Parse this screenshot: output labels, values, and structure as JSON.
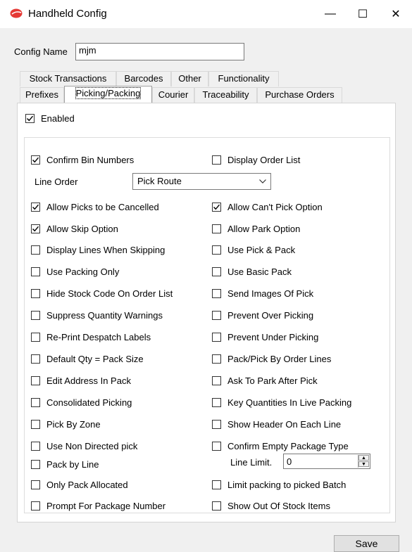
{
  "window": {
    "title": "Handheld Config",
    "minimize": "—",
    "maximize": "☐",
    "close": "✕"
  },
  "config_name": {
    "label": "Config Name",
    "value": "mjm"
  },
  "tabs_row1": [
    "Stock Transactions",
    "Barcodes",
    "Other",
    "Functionality"
  ],
  "tabs_row2": [
    "Prefixes",
    "Picking/Packing",
    "Courier",
    "Traceability",
    "Purchase Orders"
  ],
  "active_tab": "Picking/Packing",
  "enabled": {
    "label": "Enabled",
    "checked": true
  },
  "line_order": {
    "label": "Line Order",
    "value": "Pick Route"
  },
  "line_limit": {
    "label": "Line Limit.",
    "value": "0"
  },
  "left_options": [
    {
      "label": "Confirm Bin Numbers",
      "checked": true
    },
    {
      "label": "Allow Picks to be Cancelled",
      "checked": true
    },
    {
      "label": "Allow Skip Option",
      "checked": true
    },
    {
      "label": "Display Lines When Skipping",
      "checked": false
    },
    {
      "label": "Use Packing Only",
      "checked": false
    },
    {
      "label": "Hide Stock Code On Order List",
      "checked": false
    },
    {
      "label": "Suppress Quantity Warnings",
      "checked": false
    },
    {
      "label": "Re-Print Despatch Labels",
      "checked": false
    },
    {
      "label": "Default Qty = Pack Size",
      "checked": false
    },
    {
      "label": "Edit Address In Pack",
      "checked": false
    },
    {
      "label": "Consolidated Picking",
      "checked": false
    },
    {
      "label": "Pick By Zone",
      "checked": false
    },
    {
      "label": "Use Non Directed pick",
      "checked": false
    },
    {
      "label": "Pack by Line",
      "checked": false
    },
    {
      "label": "Only Pack Allocated",
      "checked": false
    },
    {
      "label": "Prompt For Package Number",
      "checked": false
    }
  ],
  "right_options": [
    {
      "label": "Display Order List",
      "checked": false
    },
    {
      "label": "Allow Can't Pick Option",
      "checked": true
    },
    {
      "label": "Allow Park Option",
      "checked": false
    },
    {
      "label": "Use Pick & Pack",
      "checked": false
    },
    {
      "label": "Use Basic Pack",
      "checked": false
    },
    {
      "label": "Send Images Of Pick",
      "checked": false
    },
    {
      "label": "Prevent Over Picking",
      "checked": false
    },
    {
      "label": "Prevent Under Picking",
      "checked": false
    },
    {
      "label": "Pack/Pick By Order Lines",
      "checked": false
    },
    {
      "label": "Ask To Park After Pick",
      "checked": false
    },
    {
      "label": "Key Quantities In Live Packing",
      "checked": false
    },
    {
      "label": "Show Header On Each Line",
      "checked": false
    },
    {
      "label": "Confirm Empty Package Type",
      "checked": false
    },
    {
      "label": "Limit packing to picked Batch",
      "checked": false
    },
    {
      "label": "Show Out Of Stock Items",
      "checked": false
    }
  ],
  "save_label": "Save"
}
